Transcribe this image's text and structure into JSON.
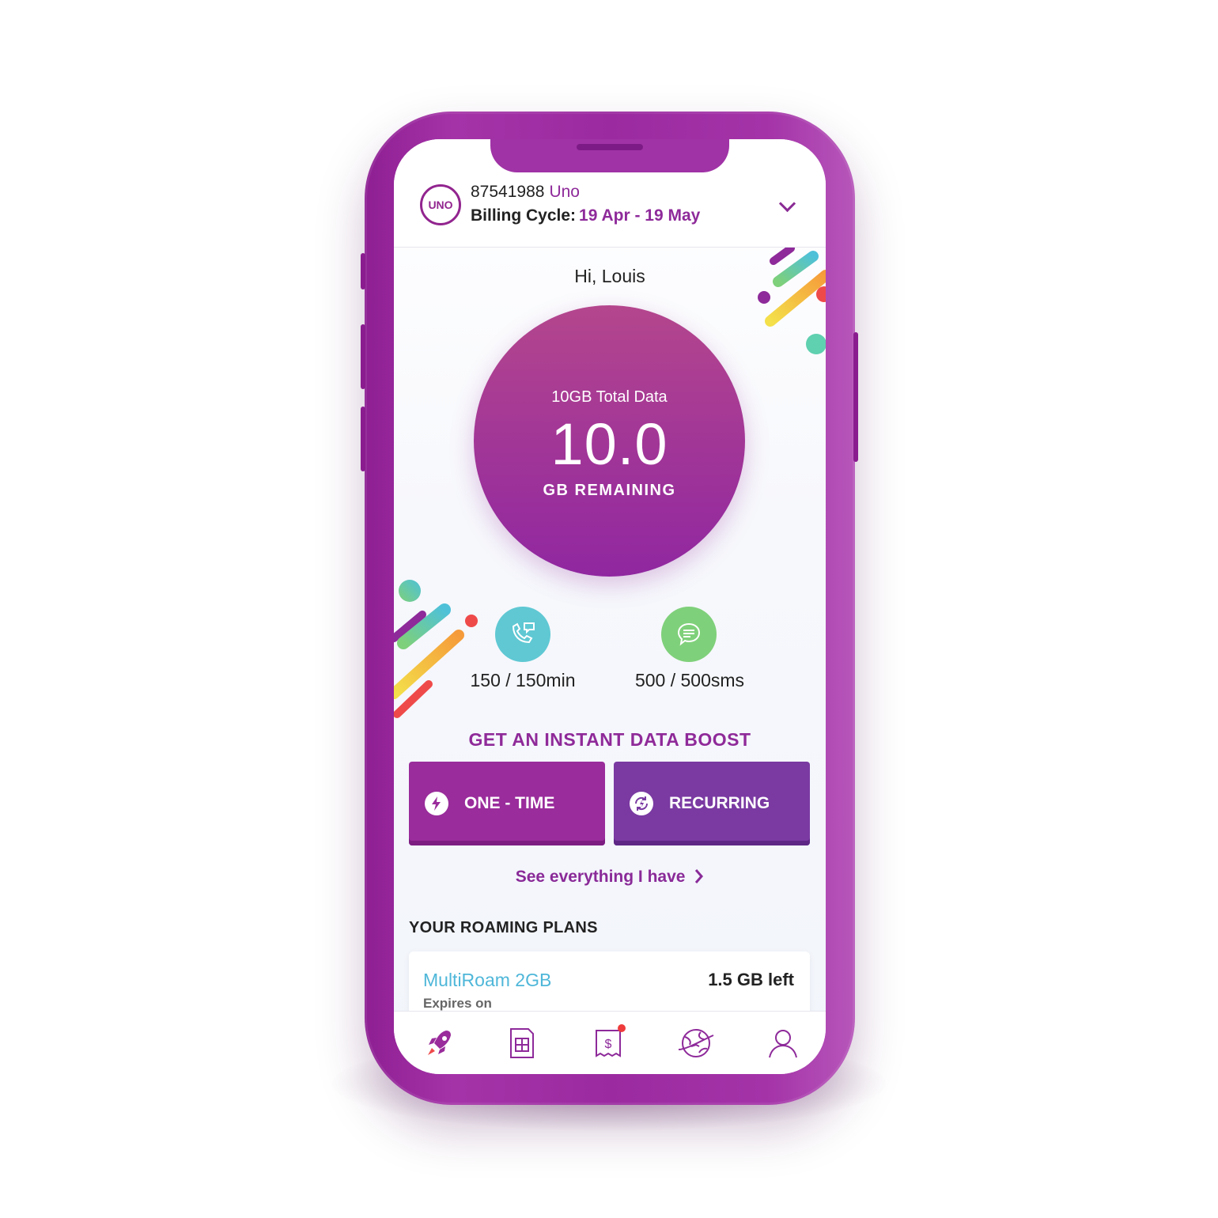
{
  "account": {
    "logo_text": "UNO",
    "number": "87541988",
    "brand": "Uno",
    "billing_label": "Billing Cycle:",
    "billing_dates": "19 Apr - 19 May"
  },
  "greeting": "Hi, Louis",
  "data_usage": {
    "total_label": "10GB Total Data",
    "remaining_value": "10.0",
    "remaining_unit": "GB REMAINING"
  },
  "voice": {
    "text": "150 / 150min",
    "icon": "phone-chat-icon",
    "color": "#5fc8d3"
  },
  "sms": {
    "text": "500 / 500sms",
    "icon": "message-icon",
    "color": "#7fd07a"
  },
  "boost": {
    "title": "GET AN INSTANT DATA BOOST",
    "one_time_label": "ONE - TIME",
    "recurring_label": "RECURRING"
  },
  "see_all": "See everything I have",
  "roaming": {
    "title": "YOUR ROAMING PLANS",
    "plans": [
      {
        "name": "MultiRoam 2GB",
        "left": "1.5 GB left",
        "expires_label": "Expires on"
      }
    ]
  },
  "tabs": [
    {
      "icon": "rocket-icon"
    },
    {
      "icon": "sim-card-icon"
    },
    {
      "icon": "bill-icon",
      "notification": true
    },
    {
      "icon": "globe-plane-icon"
    },
    {
      "icon": "profile-icon"
    }
  ],
  "colors": {
    "brand_purple": "#9a2c9b",
    "device_purple": "#a033a6",
    "accent_blue": "#4fb7d9"
  }
}
